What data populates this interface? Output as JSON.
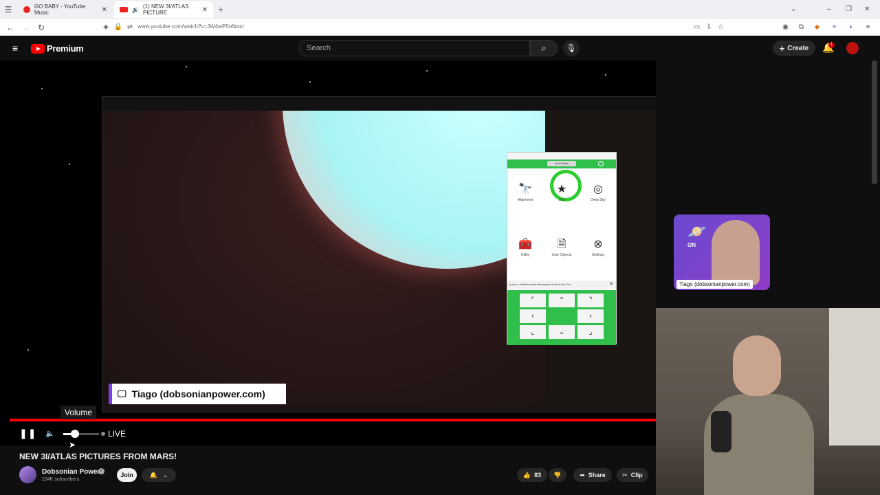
{
  "browser": {
    "tabs": [
      {
        "label": "GO BABY - YouTube Music",
        "active": false
      },
      {
        "label": "(1) NEW 3I/ATLAS PICTURE",
        "active": true
      }
    ],
    "url": "www.youtube.com/watch?v=JW4wP5n6msI"
  },
  "youtube": {
    "logo_text": "Premium",
    "search_placeholder": "Search",
    "create_label": "Create",
    "notification_count": "1"
  },
  "video": {
    "presenter_badge": "Tiago (dobsonianpower.com)",
    "cam_label": "Tiago (dobsonianpower.com)",
    "cam_on": "ON",
    "tooltip": "Volume",
    "live_label": "LIVE",
    "progress": 1.0,
    "volume": 0.35
  },
  "app": {
    "mode_button": "All-in Mode",
    "icons": [
      {
        "label": "Alignment",
        "icon": "telescope-icon"
      },
      {
        "label": "Star",
        "icon": "star-icon"
      },
      {
        "label": "Deep Sky",
        "icon": "galaxy-icon"
      },
      {
        "label": "Utility",
        "icon": "toolbox-icon"
      },
      {
        "label": "User Objects",
        "icon": "document-icon"
      },
      {
        "label": "Settings",
        "icon": "settings-icon"
      }
    ],
    "warning": "ly use a certified solar telescope to look at the Sun."
  },
  "meta": {
    "title": "NEW 3I/ATLAS PICTURES FROM MARS!",
    "channel": "Dobsonian Power",
    "subscribers": "154K subscribers",
    "join_label": "Join",
    "likes": "83",
    "share_label": "Share",
    "clip_label": "Clip"
  }
}
